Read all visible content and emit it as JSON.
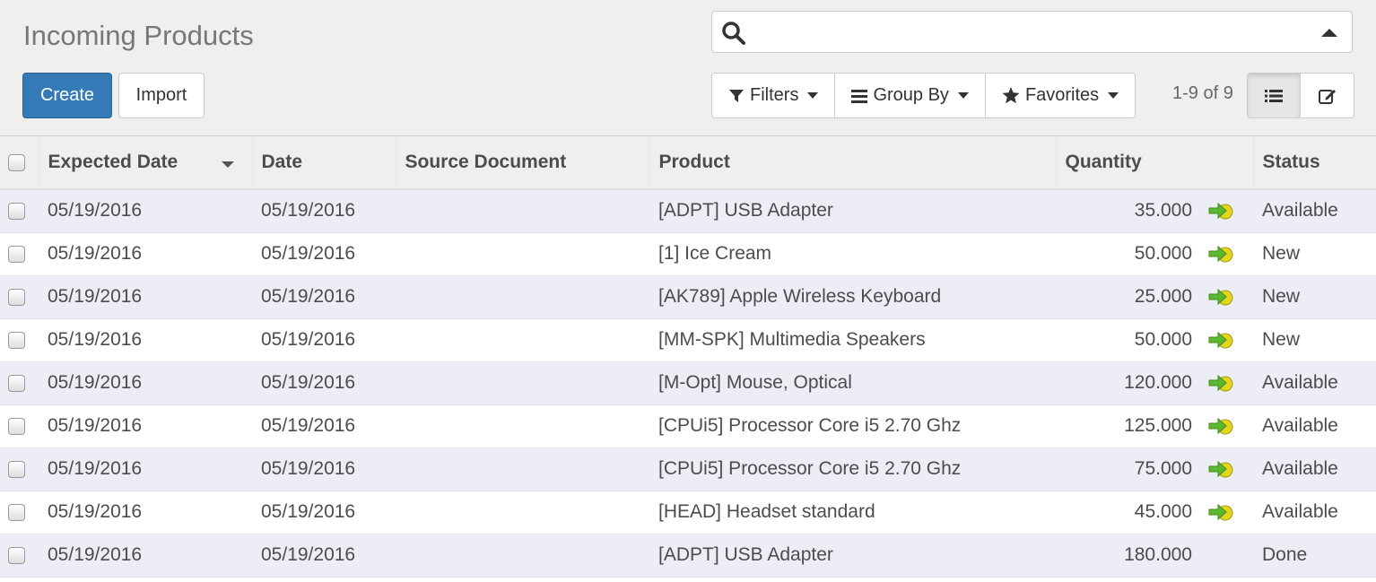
{
  "page": {
    "title": "Incoming Products"
  },
  "buttons": {
    "create": "Create",
    "import": "Import"
  },
  "search": {
    "value": "",
    "placeholder": ""
  },
  "filters": {
    "filters": "Filters",
    "group_by": "Group By",
    "favorites": "Favorites"
  },
  "pager": {
    "text": "1-9 of 9"
  },
  "table": {
    "columns": {
      "expected_date": "Expected Date",
      "date": "Date",
      "source_document": "Source Document",
      "product": "Product",
      "quantity": "Quantity",
      "status": "Status"
    },
    "rows": [
      {
        "expected_date": "05/19/2016",
        "date": "05/19/2016",
        "source_document": "",
        "product": "[ADPT] USB Adapter",
        "quantity": "35.000",
        "status": "Available",
        "arrow": true
      },
      {
        "expected_date": "05/19/2016",
        "date": "05/19/2016",
        "source_document": "",
        "product": "[1] Ice Cream",
        "quantity": "50.000",
        "status": "New",
        "arrow": true
      },
      {
        "expected_date": "05/19/2016",
        "date": "05/19/2016",
        "source_document": "",
        "product": "[AK789] Apple Wireless Keyboard",
        "quantity": "25.000",
        "status": "New",
        "arrow": true
      },
      {
        "expected_date": "05/19/2016",
        "date": "05/19/2016",
        "source_document": "",
        "product": "[MM-SPK] Multimedia Speakers",
        "quantity": "50.000",
        "status": "New",
        "arrow": true
      },
      {
        "expected_date": "05/19/2016",
        "date": "05/19/2016",
        "source_document": "",
        "product": "[M-Opt] Mouse, Optical",
        "quantity": "120.000",
        "status": "Available",
        "arrow": true
      },
      {
        "expected_date": "05/19/2016",
        "date": "05/19/2016",
        "source_document": "",
        "product": "[CPUi5] Processor Core i5 2.70 Ghz",
        "quantity": "125.000",
        "status": "Available",
        "arrow": true
      },
      {
        "expected_date": "05/19/2016",
        "date": "05/19/2016",
        "source_document": "",
        "product": "[CPUi5] Processor Core i5 2.70 Ghz",
        "quantity": "75.000",
        "status": "Available",
        "arrow": true
      },
      {
        "expected_date": "05/19/2016",
        "date": "05/19/2016",
        "source_document": "",
        "product": "[HEAD] Headset standard",
        "quantity": "45.000",
        "status": "Available",
        "arrow": true
      },
      {
        "expected_date": "05/19/2016",
        "date": "05/19/2016",
        "source_document": "",
        "product": "[ADPT] USB Adapter",
        "quantity": "180.000",
        "status": "Done",
        "arrow": false
      }
    ]
  },
  "icons": {
    "search": "search-icon",
    "filter": "filter-icon",
    "group_by": "list-icon",
    "favorites": "star-icon",
    "list_view": "list-view-icon",
    "form_view": "edit-icon",
    "row_action": "green-arrow-icon"
  },
  "colors": {
    "primary": "#337ab7",
    "row_stripe": "#ecedf5",
    "arrow_green": "#5cb82e",
    "arrow_yellow": "#e3d41c"
  }
}
